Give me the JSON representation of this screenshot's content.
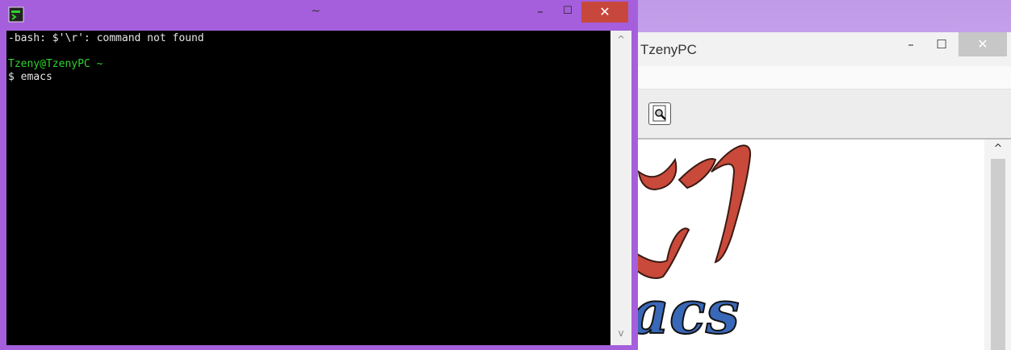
{
  "terminal": {
    "title": "~",
    "buttons": {
      "minimize": "–",
      "maximize": "☐",
      "close": "✕"
    },
    "lines": [
      "-bash: $'\\r': command not found",
      "Tzeny@TzenyPC ~",
      "$ emacs"
    ],
    "colors": {
      "prompt_user": "#2fd22f",
      "text": "#e6e6e6",
      "frame": "#a55fdc",
      "close": "#c8473d"
    },
    "scrollbar": {
      "up": "^",
      "down": "v"
    }
  },
  "emacs": {
    "title": "TzenyPC",
    "buttons": {
      "minimize": "–",
      "maximize": "☐",
      "close": "✕"
    },
    "toolbar": {
      "icon": "search-file-icon"
    },
    "scrollbar": {
      "up": "^"
    }
  }
}
